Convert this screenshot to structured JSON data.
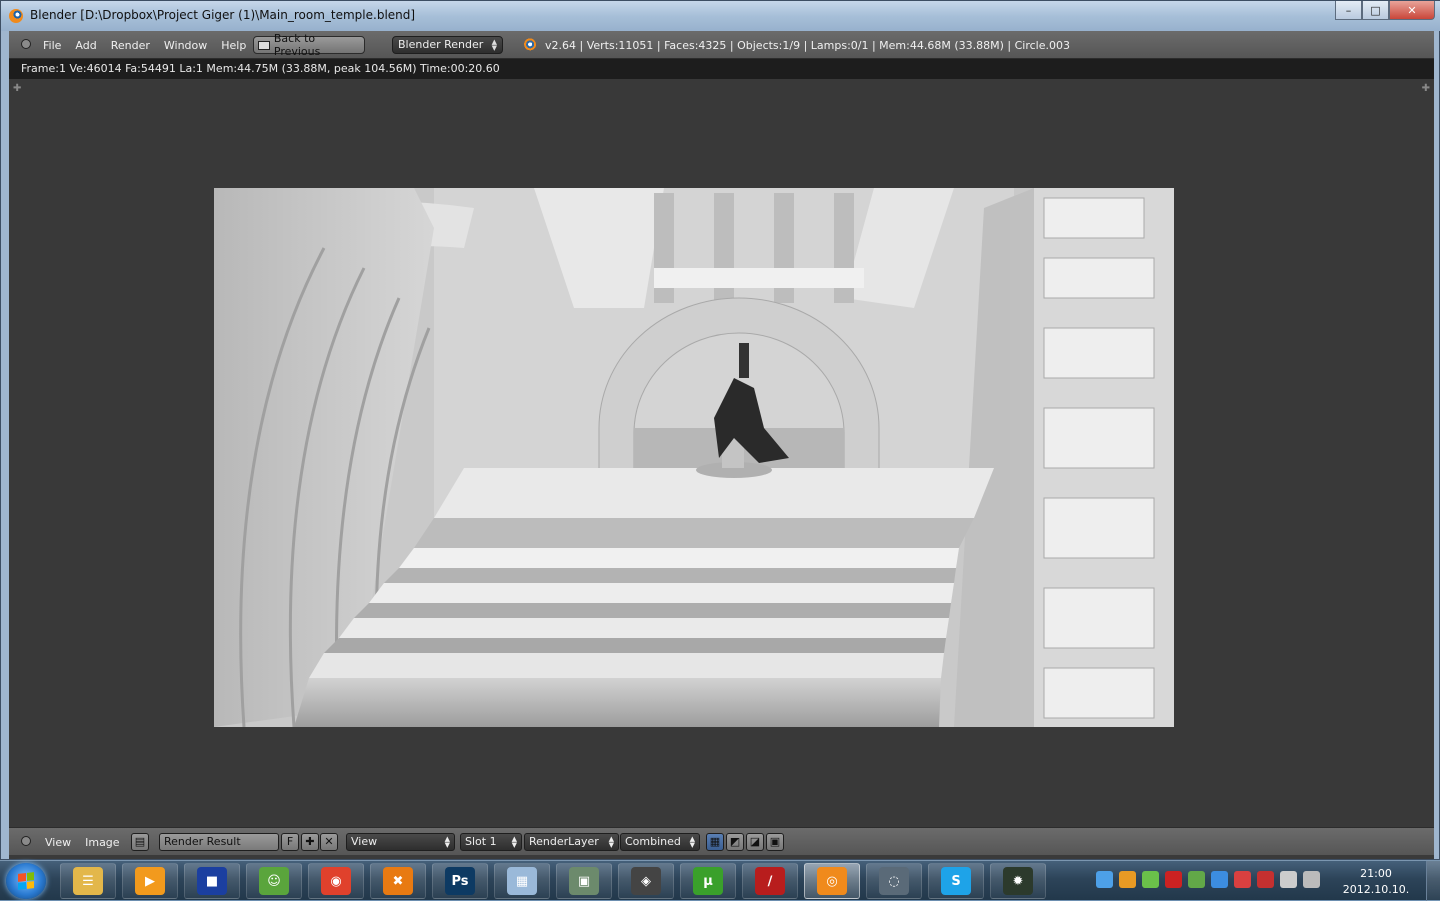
{
  "window": {
    "title": "Blender [D:\\Dropbox\\Project Giger (1)\\Main_room_temple.blend]",
    "controls": {
      "minimize": "–",
      "maximize": "□",
      "close": "✕"
    }
  },
  "info_header": {
    "menus": [
      "File",
      "Add",
      "Render",
      "Window",
      "Help"
    ],
    "back_label": "Back to Previous",
    "render_engine": "Blender Render",
    "stats": "v2.64 | Verts:11051 | Faces:4325 | Objects:1/9 | Lamps:0/1 | Mem:44.68M (33.88M) | Circle.003"
  },
  "render_info": "Frame:1 Ve:46014 Fa:54491 La:1 Mem:44.75M (33.88M, peak 104.56M) Time:00:20.60",
  "image_header": {
    "menus": [
      "View",
      "Image"
    ],
    "image_name": "Render Result",
    "fake_user": "F",
    "draw_mode": "View",
    "slot": "Slot 1",
    "layer": "RenderLayer",
    "pass": "Combined"
  },
  "taskbar": {
    "clock_time": "21:00",
    "clock_date": "2012.10.10.",
    "apps": [
      {
        "icon": "explorer-folder-icon",
        "color": "#e3b74a",
        "glyph": "☰"
      },
      {
        "icon": "media-player-icon",
        "color": "#f29a1d",
        "glyph": "▶"
      },
      {
        "icon": "save-disk-icon",
        "color": "#1b3fa0",
        "glyph": "■"
      },
      {
        "icon": "messenger-icon",
        "color": "#5aa53c",
        "glyph": "☺"
      },
      {
        "icon": "chrome-icon",
        "color": "#e0412c",
        "glyph": "◉"
      },
      {
        "icon": "cheat-engine-icon",
        "color": "#e87a12",
        "glyph": "✖"
      },
      {
        "icon": "photoshop-icon",
        "color": "#0d3a63",
        "glyph": "Ps"
      },
      {
        "icon": "calculator-icon",
        "color": "#9ab9d9",
        "glyph": "▦"
      },
      {
        "icon": "task-monitor-icon",
        "color": "#6c8a6c",
        "glyph": "▣"
      },
      {
        "icon": "unity-icon",
        "color": "#444444",
        "glyph": "◈"
      },
      {
        "icon": "utorrent-icon",
        "color": "#3aa02b",
        "glyph": "µ"
      },
      {
        "icon": "striped-app-icon",
        "color": "#b81d1d",
        "glyph": "∕"
      },
      {
        "icon": "blender-icon",
        "color": "#f08a1c",
        "glyph": "◎"
      },
      {
        "icon": "loading-ring-icon",
        "color": "#5a6a78",
        "glyph": "◌"
      },
      {
        "icon": "skype-icon",
        "color": "#1ea3e8",
        "glyph": "S"
      },
      {
        "icon": "game-app-icon",
        "color": "#2c3a2c",
        "glyph": "✹"
      }
    ],
    "tray_colors": [
      "#4da0e8",
      "#e89a24",
      "#6ac04a",
      "#cc2222",
      "#62a848",
      "#3c8de0",
      "#d94040",
      "#c43030",
      "#cccccc",
      "#bbbbbb"
    ]
  }
}
